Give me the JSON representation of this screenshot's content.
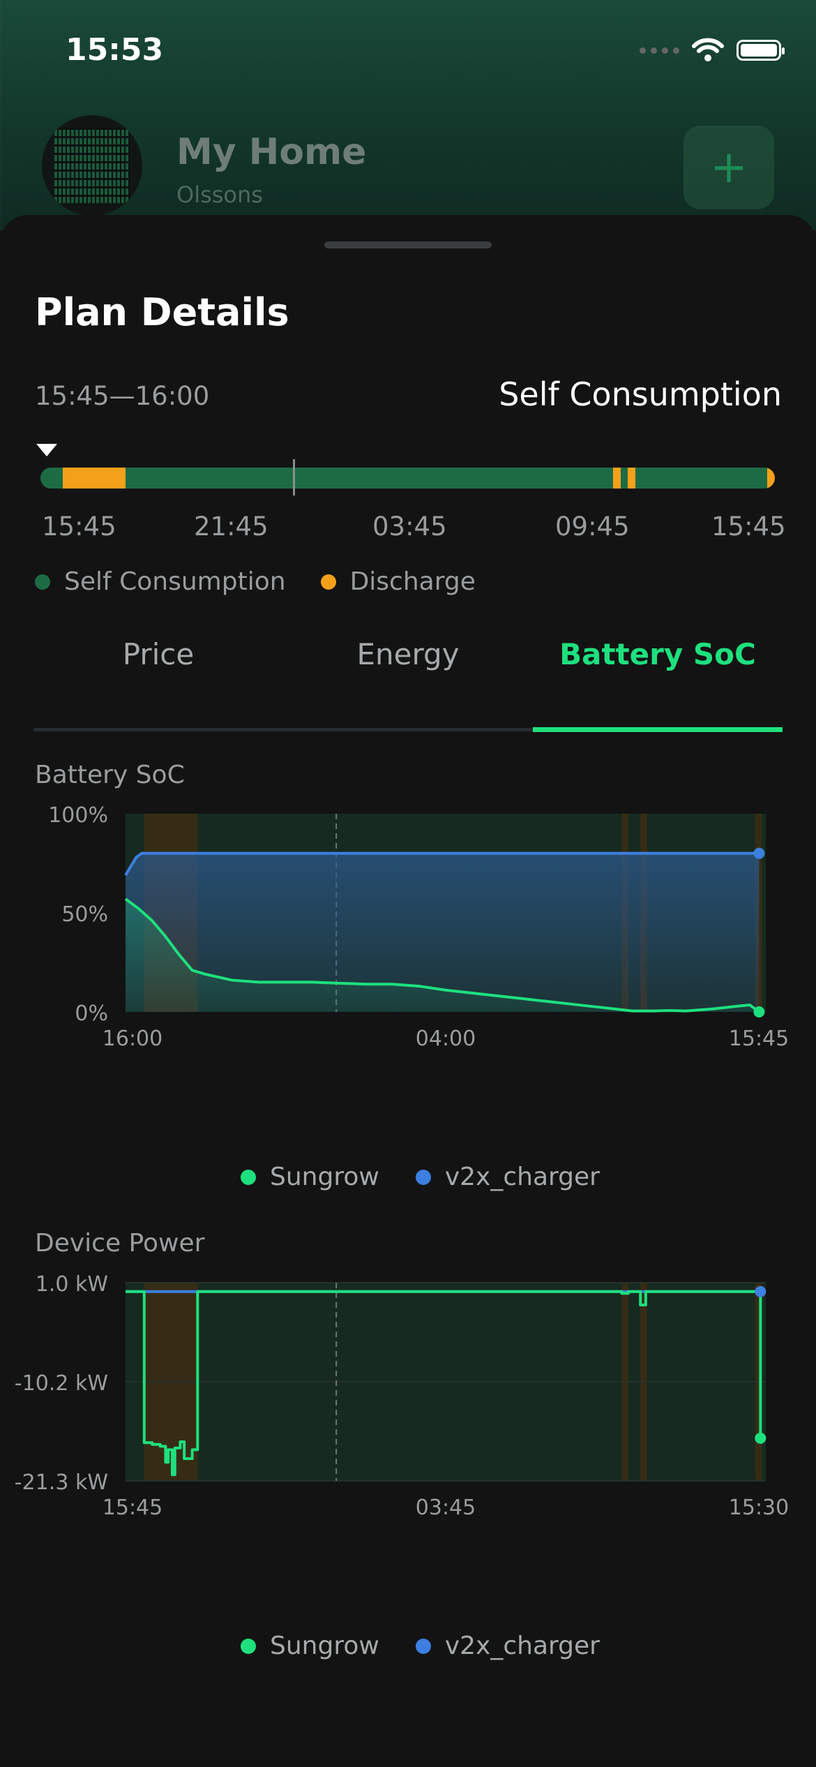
{
  "status_bar": {
    "time": "15:53"
  },
  "header": {
    "home_name": "My Home",
    "home_sub": "Olssons",
    "add_label": "+"
  },
  "sheet": {
    "title": "Plan Details",
    "time_range": "15:45—16:00",
    "mode": "Self Consumption"
  },
  "timeline": {
    "labels": [
      "15:45",
      "21:45",
      "03:45",
      "09:45",
      "15:45"
    ],
    "colors": {
      "self_consumption": "#1d6b45",
      "discharge": "#f5a01a"
    },
    "discharge_fraction_ranges": [
      [
        0.03,
        0.116
      ],
      [
        0.78,
        0.79
      ],
      [
        0.8,
        0.81
      ],
      [
        0.99,
        1.0
      ]
    ]
  },
  "legend_modes": [
    {
      "label": "Self Consumption",
      "color": "#1d6b45"
    },
    {
      "label": "Discharge",
      "color": "#f5a01a"
    }
  ],
  "tabs": [
    {
      "label": "Price",
      "active": false
    },
    {
      "label": "Energy",
      "active": false
    },
    {
      "label": "Battery SoC",
      "active": true
    }
  ],
  "battery_chart": {
    "section_label": "Battery SoC"
  },
  "power_chart": {
    "section_label": "Device Power"
  },
  "legend_devices": [
    {
      "label": "Sungrow",
      "color": "#1ee07e"
    },
    {
      "label": "v2x_charger",
      "color": "#3d7fe0"
    }
  ],
  "chart_data": [
    {
      "type": "line",
      "title": "Battery SoC",
      "y_tick_labels": [
        "100%",
        "50%",
        "0%"
      ],
      "x_tick_labels": [
        "16:00",
        "04:00",
        "15:45"
      ],
      "ylim": [
        0,
        100
      ],
      "x_hours": [
        0,
        24
      ],
      "grid": false,
      "legend_position": "bottom",
      "series": [
        {
          "name": "Sungrow",
          "color": "#1ee07e",
          "x": [
            0,
            0.5,
            1.0,
            1.5,
            2.0,
            2.5,
            3.0,
            4.0,
            5.0,
            6.0,
            7.0,
            8.0,
            9.0,
            10.0,
            11.0,
            12.0,
            13.0,
            14.0,
            15.0,
            16.0,
            17.0,
            18.0,
            19.0,
            19.8,
            20.4,
            21.0,
            22.0,
            23.0,
            23.4,
            23.75
          ],
          "y": [
            57,
            52,
            46,
            38,
            29,
            21,
            19,
            16,
            15,
            15,
            15,
            14.5,
            14,
            14,
            13,
            11,
            9.5,
            8,
            6.5,
            5,
            3.5,
            2,
            0.5,
            0.5,
            0.7,
            0.5,
            1.5,
            3,
            3.5,
            0
          ]
        },
        {
          "name": "v2x_charger",
          "color": "#3d7fe0",
          "x": [
            0,
            0.4,
            0.6,
            23.75
          ],
          "y": [
            69,
            78,
            80,
            80
          ]
        }
      ]
    },
    {
      "type": "line",
      "title": "Device Power",
      "y_tick_labels": [
        "1.0 kW",
        "-10.2 kW",
        "-21.3 kW"
      ],
      "x_tick_labels": [
        "15:45",
        "03:45",
        "15:30"
      ],
      "ylim": [
        -21.3,
        1.0
      ],
      "x_hours": [
        0,
        24
      ],
      "grid": true,
      "legend_position": "bottom",
      "series": [
        {
          "name": "Sungrow",
          "color": "#1ee07e",
          "x": [
            0,
            0.7,
            0.7,
            1.0,
            1.0,
            1.3,
            1.3,
            1.5,
            1.5,
            1.6,
            1.6,
            1.75,
            1.75,
            1.85,
            1.85,
            2.05,
            2.05,
            2.2,
            2.2,
            2.5,
            2.5,
            2.7,
            2.7,
            18.6,
            18.6,
            18.85,
            18.85,
            19.3,
            19.3,
            19.5,
            19.5,
            23.8,
            23.8
          ],
          "y": [
            0,
            0,
            -17.0,
            -17.0,
            -17.2,
            -17.2,
            -17.4,
            -17.4,
            -19.2,
            -19.2,
            -17.8,
            -17.8,
            -20.6,
            -20.6,
            -17.6,
            -17.6,
            -16.9,
            -16.9,
            -18.8,
            -18.8,
            -17.8,
            -17.8,
            0,
            0,
            -0.2,
            -0.2,
            0,
            0,
            -1.5,
            -1.5,
            0,
            0,
            -16.5
          ]
        },
        {
          "name": "v2x_charger",
          "color": "#3d7fe0",
          "x": [
            0,
            23.8
          ],
          "y": [
            0,
            0
          ]
        }
      ]
    }
  ]
}
